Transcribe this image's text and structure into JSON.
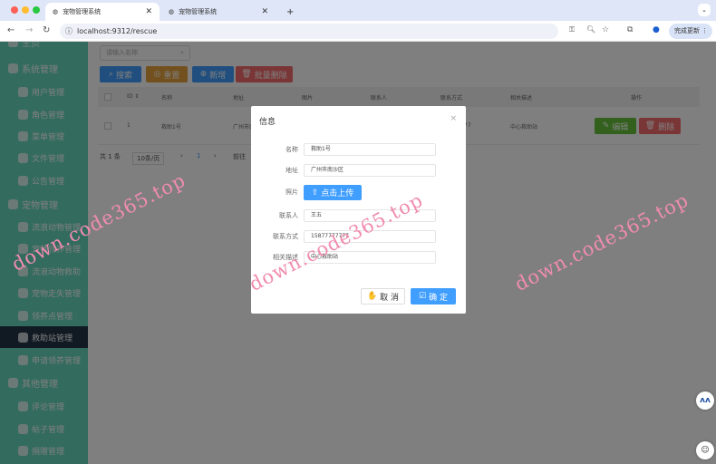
{
  "browser": {
    "tabs": [
      {
        "title": "宠物管理系统",
        "active": true
      },
      {
        "title": "宠物管理系统",
        "active": false
      }
    ],
    "new_tab": "+",
    "url": "localhost:9312/rescue",
    "update_label": "完成更新"
  },
  "sidebar": {
    "items": [
      {
        "label": "主页",
        "level": 1
      },
      {
        "label": "系统管理",
        "level": 1
      },
      {
        "label": "用户管理",
        "level": 2
      },
      {
        "label": "角色管理",
        "level": 2
      },
      {
        "label": "菜单管理",
        "level": 2
      },
      {
        "label": "文件管理",
        "level": 2
      },
      {
        "label": "公告管理",
        "level": 2
      },
      {
        "label": "宠物管理",
        "level": 1
      },
      {
        "label": "流浪动物管理",
        "level": 2
      },
      {
        "label": "宠物领养管理",
        "level": 2
      },
      {
        "label": "流浪动物救助",
        "level": 2
      },
      {
        "label": "宠物走失管理",
        "level": 2
      },
      {
        "label": "领养点管理",
        "level": 2
      },
      {
        "label": "救助站管理",
        "level": 2,
        "active": true
      },
      {
        "label": "申请领养管理",
        "level": 2
      },
      {
        "label": "其他管理",
        "level": 1
      },
      {
        "label": "评论管理",
        "level": 2
      },
      {
        "label": "帖子管理",
        "level": 2
      },
      {
        "label": "捐赠管理",
        "level": 2
      }
    ]
  },
  "toolbar": {
    "search_placeholder": "请输入名称",
    "search": "搜索",
    "reset": "重置",
    "add": "新增",
    "batch_delete": "批量删除"
  },
  "table": {
    "headers": [
      "ID ⇕",
      "名称",
      "地址",
      "图片",
      "联系人",
      "联系方式",
      "相关描述",
      "操作"
    ],
    "rows": [
      {
        "id": "1",
        "name": "救助1号",
        "address": "广州市南",
        "phone_tail": "77",
        "desc": "中心救助站"
      }
    ],
    "edit": "编辑",
    "delete": "删除"
  },
  "pagination": {
    "total": "共 1 条",
    "page_size": "10条/页",
    "prev": "‹",
    "page": "1",
    "next": "›",
    "goto": "前往"
  },
  "modal": {
    "title": "信息",
    "close": "×",
    "fields": [
      {
        "label": "名称",
        "value": "救助1号"
      },
      {
        "label": "地址",
        "value": "广州市南沙区"
      },
      {
        "label": "照片",
        "button": "点击上传"
      },
      {
        "label": "联系人",
        "value": "王五"
      },
      {
        "label": "联系方式",
        "value": "15877777777"
      },
      {
        "label": "相关描述",
        "value": "中心救助站"
      }
    ],
    "cancel": "取 消",
    "confirm": "确 定"
  },
  "watermark": "down.code365.top",
  "colors": {
    "sidebar": "#66d6be",
    "active": "#223447",
    "primary": "#409eff",
    "warning": "#e6a23c",
    "danger": "#f56c6c",
    "success": "#67c23a"
  }
}
